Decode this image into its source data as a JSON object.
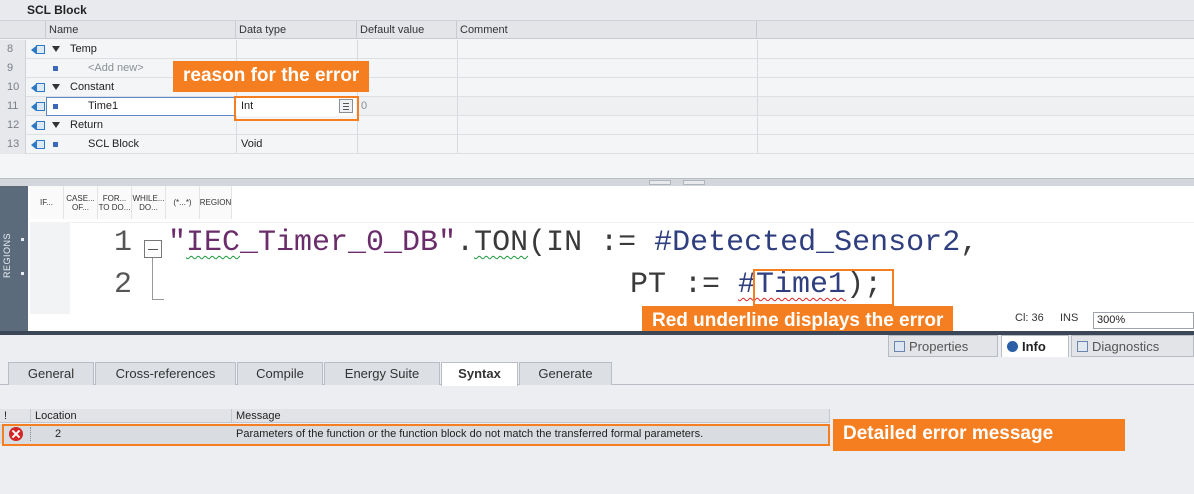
{
  "block": {
    "title": "SCL Block",
    "columns": [
      "Name",
      "Data type",
      "Default value",
      "Comment"
    ],
    "rows": [
      {
        "num": "8",
        "name": "Temp",
        "type": "",
        "default": "",
        "kind": "section"
      },
      {
        "num": "9",
        "name": "<Add new>",
        "type": "",
        "default": "",
        "kind": "add"
      },
      {
        "num": "10",
        "name": "Constant",
        "type": "",
        "default": "",
        "kind": "section"
      },
      {
        "num": "11",
        "name": "Time1",
        "type": "Int",
        "default": "0",
        "kind": "item"
      },
      {
        "num": "12",
        "name": "Return",
        "type": "",
        "default": "",
        "kind": "section"
      },
      {
        "num": "13",
        "name": "SCL Block",
        "type": "Void",
        "default": "",
        "kind": "item"
      }
    ]
  },
  "callouts": {
    "reason": "reason for the error",
    "underline": "Red underline displays the error",
    "detail": "Detailed error message"
  },
  "editor": {
    "regions_label": "REGIONS",
    "toolbar": [
      {
        "id": "if",
        "label": "IF..."
      },
      {
        "id": "case",
        "label": "CASE... OF..."
      },
      {
        "id": "for",
        "label": "FOR... TO DO..."
      },
      {
        "id": "while",
        "label": "WHILE... DO..."
      },
      {
        "id": "comment",
        "label": "(*...*)"
      },
      {
        "id": "region",
        "label": "REGION"
      }
    ],
    "line1_num": "1",
    "line2_num": "2",
    "line1_str1": "\"",
    "line1_iec": "IEC",
    "line1_str2": "_Timer_0_DB\"",
    "line1_dot": ".",
    "line1_ton": "TON",
    "line1_rest": "(IN := ",
    "line1_var": "#Detected_Sensor2",
    "line1_end": ",",
    "line2_pre": "PT := ",
    "line2_var": "#Time1",
    "line2_end": ");",
    "status_col": "Cl: 36",
    "status_mode": "INS",
    "zoom": "300%"
  },
  "inspector": {
    "tabs": [
      "Properties",
      "Info",
      "Diagnostics"
    ],
    "subtabs": [
      "General",
      "Cross-references",
      "Compile",
      "Energy Suite",
      "Syntax",
      "Generate"
    ],
    "active_subtab": "Syntax",
    "columns": {
      "mark": "!",
      "location": "Location",
      "message": "Message"
    },
    "messages": [
      {
        "location": "2",
        "message": "Parameters of the function or the function block do not match the transferred formal parameters."
      }
    ]
  },
  "colors": {
    "accent": "#f47e20",
    "error": "#d32727"
  }
}
